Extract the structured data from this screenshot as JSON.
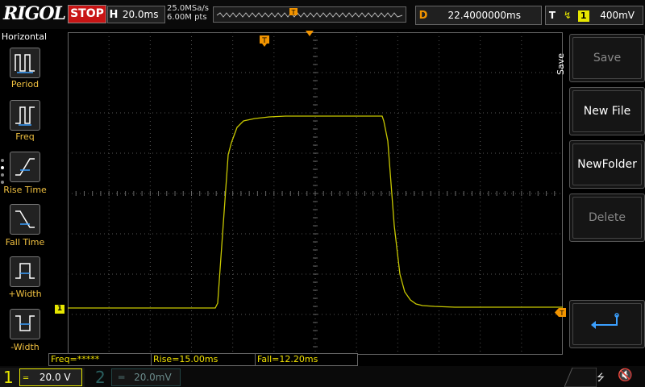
{
  "brand": "RIGOL",
  "run_state": "STOP",
  "horizontal": {
    "key": "H",
    "timebase": "20.0ms",
    "sample_rate": "25.0MSa/s",
    "memory_depth": "6.00M pts"
  },
  "delay": {
    "key": "D",
    "value": "22.4000000ms"
  },
  "trigger": {
    "key": "T",
    "channel": "1",
    "level": "400mV",
    "marker": "T"
  },
  "left_menu": {
    "title": "Horizontal",
    "items": [
      {
        "label": "Period",
        "icon": "period-icon"
      },
      {
        "label": "Freq",
        "icon": "freq-icon"
      },
      {
        "label": "Rise Time",
        "icon": "rise-time-icon"
      },
      {
        "label": "Fall Time",
        "icon": "fall-time-icon"
      },
      {
        "label": "+Width",
        "icon": "positive-width-icon"
      },
      {
        "label": "-Width",
        "icon": "negative-width-icon"
      }
    ]
  },
  "right_menu": {
    "title": "Save",
    "items": [
      {
        "label": "Save",
        "enabled": false
      },
      {
        "label": "New File",
        "enabled": true
      },
      {
        "label": "NewFolder",
        "enabled": true
      },
      {
        "label": "Delete",
        "enabled": false
      },
      {
        "label": "",
        "icon": "return-icon",
        "enabled": true
      }
    ]
  },
  "measurements": {
    "freq": "Freq=*****",
    "rise": "Rise=15.00ms",
    "fall": "Fall=12.20ms"
  },
  "channel1": {
    "num": "1",
    "scale": "20.0 V",
    "marker": "1",
    "color": "#e6e600"
  },
  "channel2": {
    "num": "2",
    "scale": "20.0mV",
    "color": "#2a6060"
  },
  "status": {
    "usb_icon": "usb-icon",
    "sound_icon": "speaker-muted-icon"
  }
}
